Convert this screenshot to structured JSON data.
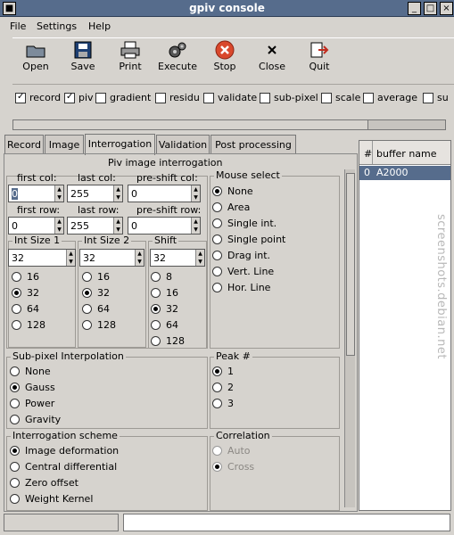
{
  "window": {
    "title": "gpiv console"
  },
  "menu": [
    "File",
    "Settings",
    "Help"
  ],
  "toolbar": [
    {
      "label": "Open",
      "icon": "folder-icon"
    },
    {
      "label": "Save",
      "icon": "floppy-icon"
    },
    {
      "label": "Print",
      "icon": "printer-icon"
    },
    {
      "label": "Execute",
      "icon": "gears-icon"
    },
    {
      "label": "Stop",
      "icon": "stop-icon"
    },
    {
      "label": "Close",
      "icon": "close-icon"
    },
    {
      "label": "Quit",
      "icon": "quit-icon"
    }
  ],
  "checks": [
    {
      "label": "record",
      "checked": true
    },
    {
      "label": "piv",
      "checked": true
    },
    {
      "label": "gradient",
      "checked": false
    },
    {
      "label": "residu",
      "checked": false
    },
    {
      "label": "validate",
      "checked": false
    },
    {
      "label": "sub-pixel",
      "checked": false
    },
    {
      "label": "scale",
      "checked": false
    },
    {
      "label": "average",
      "checked": false
    },
    {
      "label": "su",
      "checked": false
    }
  ],
  "tabs": [
    "Record",
    "Image",
    "Interrogation",
    "Validation",
    "Post processing"
  ],
  "panel": {
    "title": "Piv image interrogation",
    "fields": {
      "first_col": {
        "label": "first col:",
        "value": "0"
      },
      "last_col": {
        "label": "last col:",
        "value": "255"
      },
      "preshift_col": {
        "label": "pre-shift col:",
        "value": "0"
      },
      "first_row": {
        "label": "first row:",
        "value": "0"
      },
      "last_row": {
        "label": "last row:",
        "value": "255"
      },
      "preshift_row": {
        "label": "pre-shift row:",
        "value": "0"
      }
    },
    "mouse_select": {
      "title": "Mouse select",
      "options": [
        "None",
        "Area",
        "Single int.",
        "Single point",
        "Drag int.",
        "Vert. Line",
        "Hor. Line"
      ],
      "selected": 0
    },
    "int_size_1": {
      "title": "Int Size 1",
      "value": "32",
      "options": [
        "16",
        "32",
        "64",
        "128"
      ],
      "selected": 1
    },
    "int_size_2": {
      "title": "Int Size 2",
      "value": "32",
      "options": [
        "16",
        "32",
        "64",
        "128"
      ],
      "selected": 1
    },
    "shift": {
      "title": "Shift",
      "value": "32",
      "options": [
        "8",
        "16",
        "32",
        "64",
        "128"
      ],
      "selected": 2
    },
    "subpixel": {
      "title": "Sub-pixel Interpolation",
      "options": [
        "None",
        "Gauss",
        "Power",
        "Gravity"
      ],
      "selected": 1
    },
    "peak": {
      "title": "Peak #",
      "options": [
        "1",
        "2",
        "3"
      ],
      "selected": 0
    },
    "scheme": {
      "title": "Interrogation scheme",
      "options": [
        "Image deformation",
        "Central differential",
        "Zero offset",
        "Weight Kernel"
      ],
      "selected": 0
    },
    "correlation": {
      "title": "Correlation",
      "options": [
        "Auto",
        "Cross"
      ],
      "selected": 1
    }
  },
  "buffer": {
    "col_num": "#",
    "col_name": "buffer name",
    "row_num": "0",
    "row_name": "A2000"
  },
  "watermark": "screenshots.debian.net"
}
